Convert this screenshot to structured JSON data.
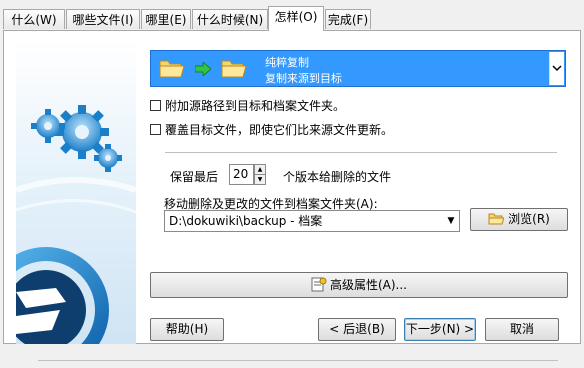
{
  "tabs": [
    {
      "label": "什么(W)"
    },
    {
      "label": "哪些文件(I)"
    },
    {
      "label": "哪里(E)"
    },
    {
      "label": "什么时候(N)"
    },
    {
      "label": "怎样(O)"
    },
    {
      "label": "完成(F)"
    }
  ],
  "active_tab": "怎样(O)",
  "copy_mode": {
    "title": "纯粹复制",
    "subtitle": "复制来源到目标"
  },
  "options": {
    "append_path_label": "附加源路径到目标和档案文件夹。",
    "append_path_checked": false,
    "overwrite_label": "覆盖目标文件，即使它们比来源文件更新。",
    "overwrite_checked": false
  },
  "versions": {
    "prefix": "保留最后",
    "value": "20",
    "suffix": "个版本给删除的文件"
  },
  "archive": {
    "label": "移动删除及更改的文件到档案文件夹(A):",
    "path": "D:\\dokuwiki\\backup - 档案",
    "browse_label": "浏览(R)"
  },
  "advanced_label": "高级属性(A)...",
  "footer": {
    "help": "帮助(H)",
    "back": "< 后退(B)",
    "next": "下一步(N) >",
    "cancel": "取消"
  },
  "colors": {
    "dropdown_selected": "#3399ff",
    "sidebar_blue": "#1f86d2"
  }
}
